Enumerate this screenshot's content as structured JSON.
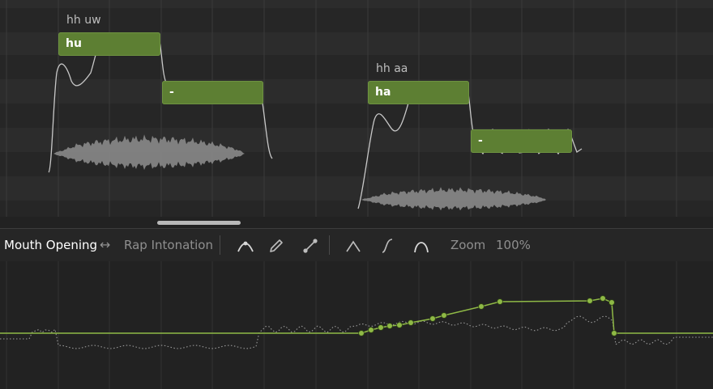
{
  "notes": [
    {
      "lyric": "hu",
      "phonemes": "hh uw"
    },
    {
      "lyric": "-",
      "phonemes": ""
    },
    {
      "lyric": "ha",
      "phonemes": "hh aa"
    },
    {
      "lyric": "-",
      "phonemes": ""
    }
  ],
  "toolbar": {
    "parameter_label": "Mouth Opening",
    "swap_symbol": "↔",
    "secondary_parameter_label": "Rap Intonation",
    "zoom_label": "Zoom",
    "zoom_value": "100%",
    "tools": [
      "curve-select-icon",
      "pencil-icon",
      "line-tool-icon"
    ],
    "shapes": [
      "peak-shape-icon",
      "s-curve-shape-icon",
      "arch-shape-icon"
    ]
  },
  "colors": {
    "note_fill": "#5d7f33",
    "parameter_curve": "#8fb946",
    "pitch_curve": "#c8c8c8",
    "waveform": "#8a8a8a",
    "label_active": "#ffffff",
    "label_inactive": "#8f8f8f"
  }
}
